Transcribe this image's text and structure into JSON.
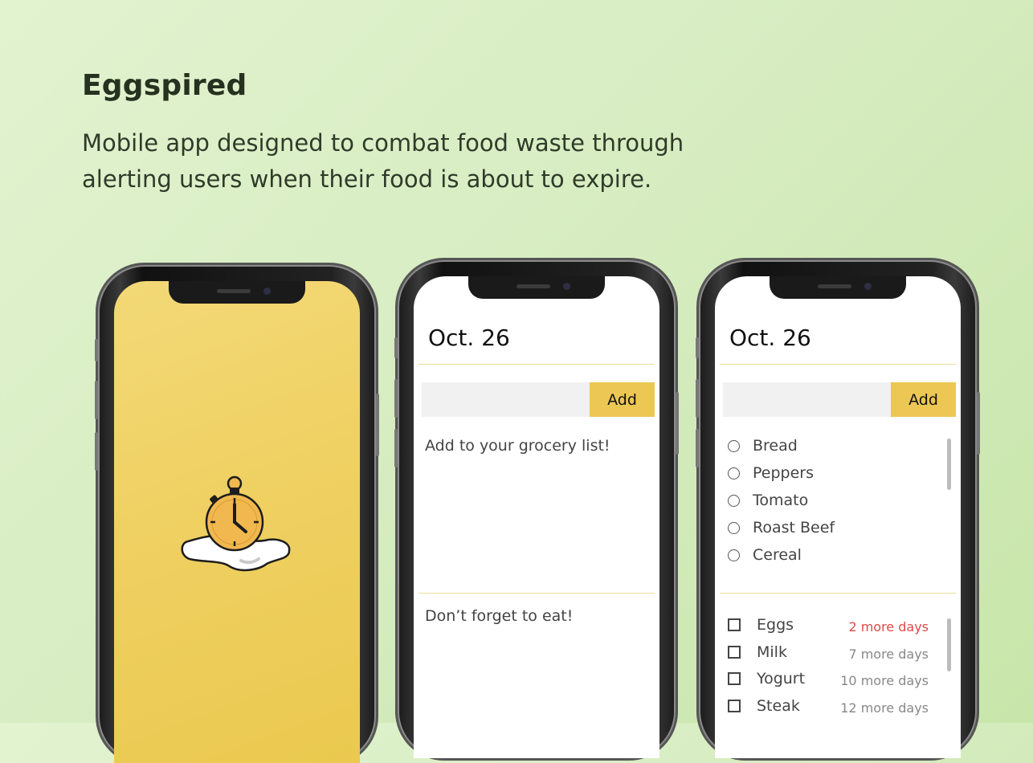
{
  "header": {
    "title": "Eggspired",
    "description": "Mobile app designed to combat food waste through alerting users when their food is about to expire."
  },
  "phone2": {
    "date": "Oct. 26",
    "add_label": "Add",
    "grocery_hint": "Add to your grocery list!",
    "eat_hint": "Don’t forget to eat!"
  },
  "phone3": {
    "date": "Oct. 26",
    "add_label": "Add",
    "grocery_items": [
      {
        "label": "Bread"
      },
      {
        "label": "Peppers"
      },
      {
        "label": "Tomato"
      },
      {
        "label": "Roast Beef"
      },
      {
        "label": "Cereal"
      }
    ],
    "pantry_items": [
      {
        "label": "Eggs",
        "days": "2 more days",
        "urgent": true
      },
      {
        "label": "Milk",
        "days": "7 more days",
        "urgent": false
      },
      {
        "label": "Yogurt",
        "days": "10 more days",
        "urgent": false
      },
      {
        "label": "Steak",
        "days": "12 more days",
        "urgent": false
      }
    ]
  },
  "colors": {
    "accent": "#ecc753",
    "urgent": "#e04848",
    "splash": "#efd062"
  },
  "icons": {
    "splash_logo": "egg-stopwatch-icon"
  }
}
